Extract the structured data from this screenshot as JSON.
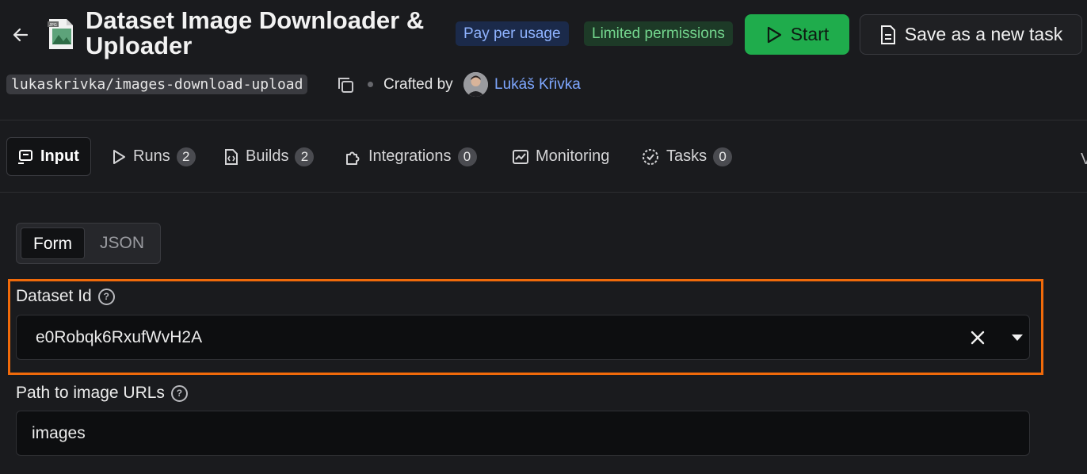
{
  "header": {
    "title": "Dataset Image Downloader & Uploader",
    "badges": {
      "pricing": "Pay per usage",
      "permissions": "Limited permissions"
    },
    "start_label": "Start",
    "save_label": "Save as a new task",
    "slug": "lukaskrivka/images-download-upload",
    "crafted_by": "Crafted by",
    "author": "Lukáš Křivka",
    "icons": {
      "back": "arrow-left-icon",
      "app": "jpg-file-icon",
      "start": "play-icon",
      "save": "document-icon",
      "copy": "copy-icon",
      "avatar": "avatar"
    }
  },
  "tabs": [
    {
      "label": "Input",
      "icon": "input-icon",
      "active": true
    },
    {
      "label": "Runs",
      "count": "2",
      "icon": "play-outline-icon"
    },
    {
      "label": "Builds",
      "count": "2",
      "icon": "build-file-icon"
    },
    {
      "label": "Integrations",
      "count": "0",
      "icon": "puzzle-icon"
    },
    {
      "label": "Monitoring",
      "icon": "chart-icon"
    },
    {
      "label": "Tasks",
      "count": "0",
      "icon": "task-check-icon"
    }
  ],
  "tabs_overflow": "V",
  "input": {
    "modes": [
      "Form",
      "JSON"
    ],
    "selected_mode": "Form",
    "fields": {
      "dataset_id": {
        "label": "Dataset Id",
        "value": "e0Robqk6RxufWvH2A"
      },
      "path": {
        "label": "Path to image URLs",
        "value": "images"
      }
    }
  },
  "colors": {
    "accent_start": "#1fac4c",
    "highlight_border": "#f06a0a",
    "link": "#7ea7ff"
  }
}
